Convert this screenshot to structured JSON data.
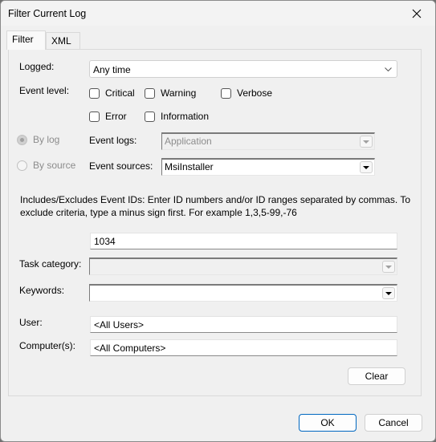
{
  "window": {
    "title": "Filter Current Log",
    "close_icon": "close-icon"
  },
  "tabs": [
    {
      "label": "Filter",
      "active": true
    },
    {
      "label": "XML",
      "active": false
    }
  ],
  "filter": {
    "logged": {
      "label": "Logged:",
      "value": "Any time"
    },
    "event_level": {
      "label": "Event level:",
      "options": [
        {
          "label": "Critical",
          "checked": false
        },
        {
          "label": "Warning",
          "checked": false
        },
        {
          "label": "Verbose",
          "checked": false
        },
        {
          "label": "Error",
          "checked": false
        },
        {
          "label": "Information",
          "checked": false
        }
      ]
    },
    "by_log": {
      "label": "By log",
      "selected": true,
      "disabled": true
    },
    "by_source": {
      "label": "By source",
      "selected": false,
      "disabled": true
    },
    "event_logs": {
      "label": "Event logs:",
      "value": "Application",
      "disabled": true
    },
    "event_sources": {
      "label": "Event sources:",
      "value": "MsiInstaller"
    },
    "event_ids_description": "Includes/Excludes Event IDs: Enter ID numbers and/or ID ranges separated by commas. To exclude criteria, type a minus sign first. For example 1,3,5-99,-76",
    "event_ids": {
      "value": "1034"
    },
    "task_category": {
      "label": "Task category:",
      "value": "",
      "disabled": true
    },
    "keywords": {
      "label": "Keywords:",
      "value": ""
    },
    "user": {
      "label": "User:",
      "value": "<All Users>"
    },
    "computers": {
      "label": "Computer(s):",
      "value": "<All Computers>"
    },
    "clear_label": "Clear"
  },
  "footer": {
    "ok_label": "OK",
    "cancel_label": "Cancel"
  }
}
